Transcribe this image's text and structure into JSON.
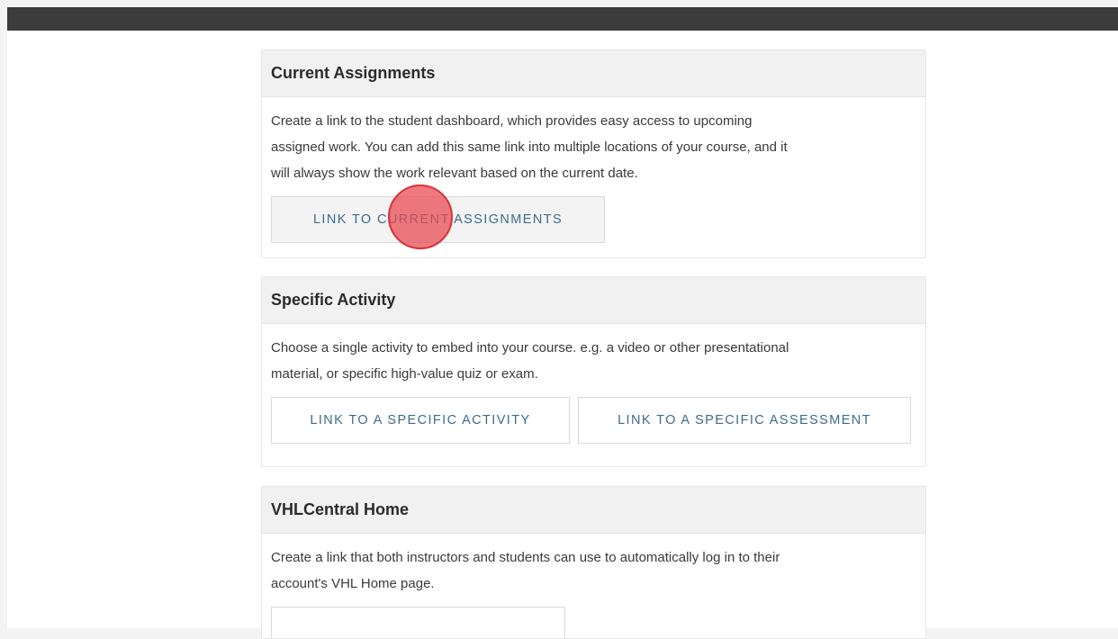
{
  "cards": [
    {
      "title": "Current Assignments",
      "description_lines": [
        "Create a link to the student dashboard, which provides easy access to upcoming",
        "assigned work. You can add this same link into multiple locations of your course, and it",
        "will always show the work relevant based on the current date."
      ],
      "buttons": [
        "LINK TO CURRENT ASSIGNMENTS"
      ]
    },
    {
      "title": "Specific Activity",
      "description_lines": [
        "Choose a single activity to embed into your course. e.g. a video or other presentational",
        "material, or specific high-value quiz or exam."
      ],
      "buttons": [
        "LINK TO A SPECIFIC ACTIVITY",
        "LINK TO A SPECIFIC ASSESSMENT"
      ]
    },
    {
      "title": "VHLCentral Home",
      "description_lines": [
        "Create a link that both instructors and students can use to automatically log in to their",
        "account's VHL Home page."
      ],
      "buttons": [
        ""
      ]
    }
  ],
  "colors": {
    "top_bar": "#3c3c3c",
    "button_text": "#3d6b8c",
    "click_marker": "#e8464e"
  }
}
